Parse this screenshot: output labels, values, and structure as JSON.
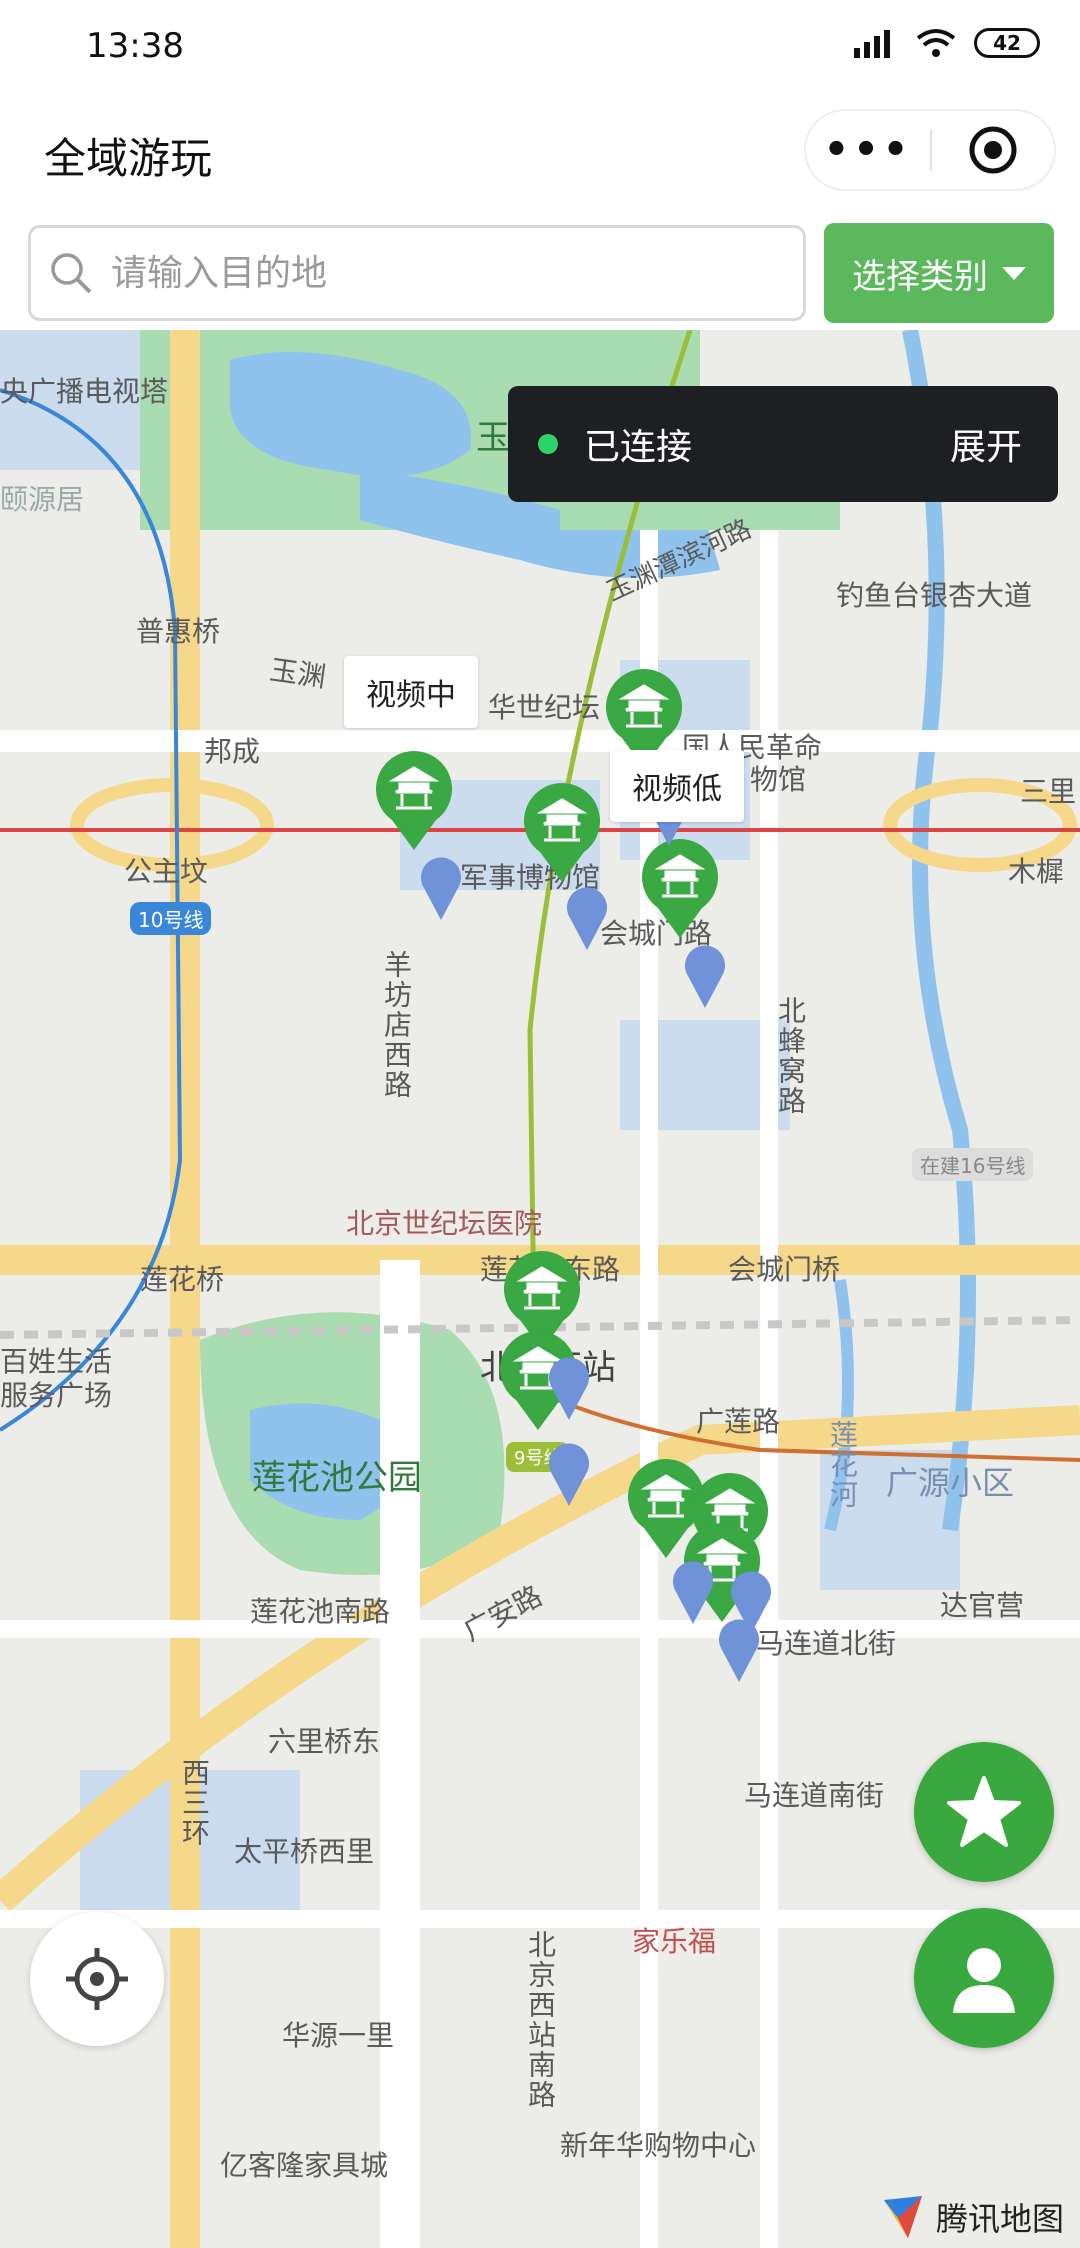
{
  "status_bar": {
    "time": "13:38",
    "battery": "42",
    "icons": [
      "signal-icon",
      "wifi-icon",
      "battery-icon"
    ]
  },
  "nav": {
    "title": "全域游玩",
    "more_icon": "more-dots-icon",
    "close_icon": "target-circle-icon"
  },
  "search": {
    "placeholder": "请输入目的地",
    "icon": "search-icon"
  },
  "category": {
    "label": "选择类别"
  },
  "connection": {
    "status": "已连接",
    "expand": "展开"
  },
  "callouts": {
    "video_on": "视频中",
    "video_low": "视频低"
  },
  "map_labels": {
    "tower": "央广播电视塔",
    "yuyuantan": "玉渊潭公园",
    "yuyuan_south": "颐源居",
    "puhuiqiao": "普惠桥",
    "yuyuanbinhe": "玉渊潭滨河路",
    "diaoyutai": "钓鱼台银杏大道",
    "yuyuan2": "玉渊",
    "shijitan_gongyuan": "华世纪坛",
    "bangcheng": "邦成",
    "revolution_museum": "国人民革命",
    "bowuguan": "物馆",
    "gongzhufen": "公主坟",
    "line10": "10号线",
    "junshi_museum": "军事博物馆",
    "sanli": "三里",
    "muxidi": "木樨",
    "huichengmen_road": "会城门路",
    "yangfangdian": "羊坊店西路",
    "beifengwo": "北蜂窝路",
    "line16": "在建16号线",
    "shijitan_hospital": "北京世纪坛医院",
    "lianhuaqiao": "莲花桥",
    "lianhuachi_east": "莲花池东路",
    "huichengmenqiao": "会城门桥",
    "baixing": "百姓生活",
    "baixing2": "服务广场",
    "west_station": "北京西站",
    "guanglian": "广莲路",
    "lianhuahe": "莲花河",
    "guangyuan": "广源小区",
    "lianhuachi_park": "莲花池公园",
    "line9": "9号线",
    "dagunying": "达官营",
    "lianhuachi_south": "莲花池南路",
    "guanganlu": "广安路",
    "maliandao_north": "马连道北街",
    "liuliqiao_east": "六里桥东",
    "west3ring": "西三环",
    "maliandao_south": "马连道南街",
    "taipingqiao": "太平桥西里",
    "carrefour": "家乐福",
    "beijing_west_south": "北京西站南路",
    "huayuan": "华源一里",
    "yikelong": "亿客隆家具城",
    "xinnianhua": "新年华购物中心"
  },
  "brand": {
    "name": "腾讯地图"
  },
  "colors": {
    "accent_green": "#39a93f",
    "button_green": "#5cb85c",
    "pin_blue": "#6f92d8",
    "connect_dot": "#2bd46a"
  }
}
